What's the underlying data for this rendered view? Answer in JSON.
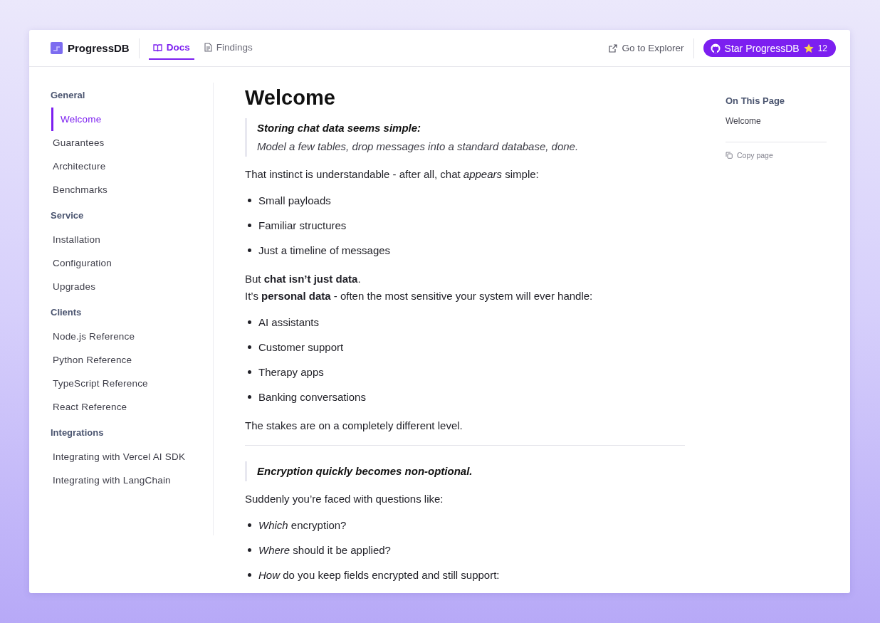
{
  "header": {
    "brand": "ProgressDB",
    "tabs": [
      {
        "label": "Docs",
        "selected": true
      },
      {
        "label": "Findings",
        "selected": false
      }
    ],
    "explorer_link": "Go to Explorer",
    "star_button": {
      "label": "Star ProgressDB",
      "count": "12"
    }
  },
  "sidebar": {
    "groups": [
      {
        "title": "General",
        "items": [
          {
            "label": "Welcome",
            "selected": true
          },
          {
            "label": "Guarantees",
            "selected": false
          },
          {
            "label": "Architecture",
            "selected": false
          },
          {
            "label": "Benchmarks",
            "selected": false
          }
        ]
      },
      {
        "title": "Service",
        "items": [
          {
            "label": "Installation",
            "selected": false
          },
          {
            "label": "Configuration",
            "selected": false
          },
          {
            "label": "Upgrades",
            "selected": false
          }
        ]
      },
      {
        "title": "Clients",
        "items": [
          {
            "label": "Node.js Reference",
            "selected": false
          },
          {
            "label": "Python Reference",
            "selected": false
          },
          {
            "label": "TypeScript Reference",
            "selected": false
          },
          {
            "label": "React Reference",
            "selected": false
          }
        ]
      },
      {
        "title": "Integrations",
        "items": [
          {
            "label": "Integrating with Vercel AI SDK",
            "selected": false
          },
          {
            "label": "Integrating with LangChain",
            "selected": false
          }
        ]
      }
    ]
  },
  "article": {
    "title": "Welcome",
    "blocks": [
      {
        "kind": "quote",
        "lines": [
          {
            "text": "Storing chat data seems simple:",
            "strong": true
          },
          {
            "text": "Model a few tables, drop messages into a standard database, done.",
            "strong": false
          }
        ]
      },
      {
        "kind": "para",
        "text": "That instinct is understandable - after all, chat *appears* simple:"
      },
      {
        "kind": "list",
        "items": [
          "Small payloads",
          "Familiar structures",
          "Just a timeline of messages"
        ]
      },
      {
        "kind": "para",
        "text": "But **chat isn’t just data**."
      },
      {
        "kind": "para",
        "text": "It’s **personal data** - often the most sensitive your system will ever handle:"
      },
      {
        "kind": "list",
        "items": [
          "AI assistants",
          "Customer support",
          "Therapy apps",
          "Banking conversations"
        ]
      },
      {
        "kind": "para",
        "text": "The stakes are on a completely different level."
      },
      {
        "kind": "rule"
      },
      {
        "kind": "quote",
        "lines": [
          {
            "text": "Encryption quickly becomes non-optional.",
            "strong": true
          }
        ]
      },
      {
        "kind": "para",
        "text": "Suddenly you’re faced with questions like:"
      },
      {
        "kind": "list",
        "items": [
          "*Which* encryption?",
          "*Where* should it be applied?",
          "*How* do you keep fields encrypted and still support:"
        ]
      }
    ]
  },
  "toc": {
    "title": "On This Page",
    "items": [
      "Welcome"
    ],
    "copy_button": "Copy page"
  }
}
